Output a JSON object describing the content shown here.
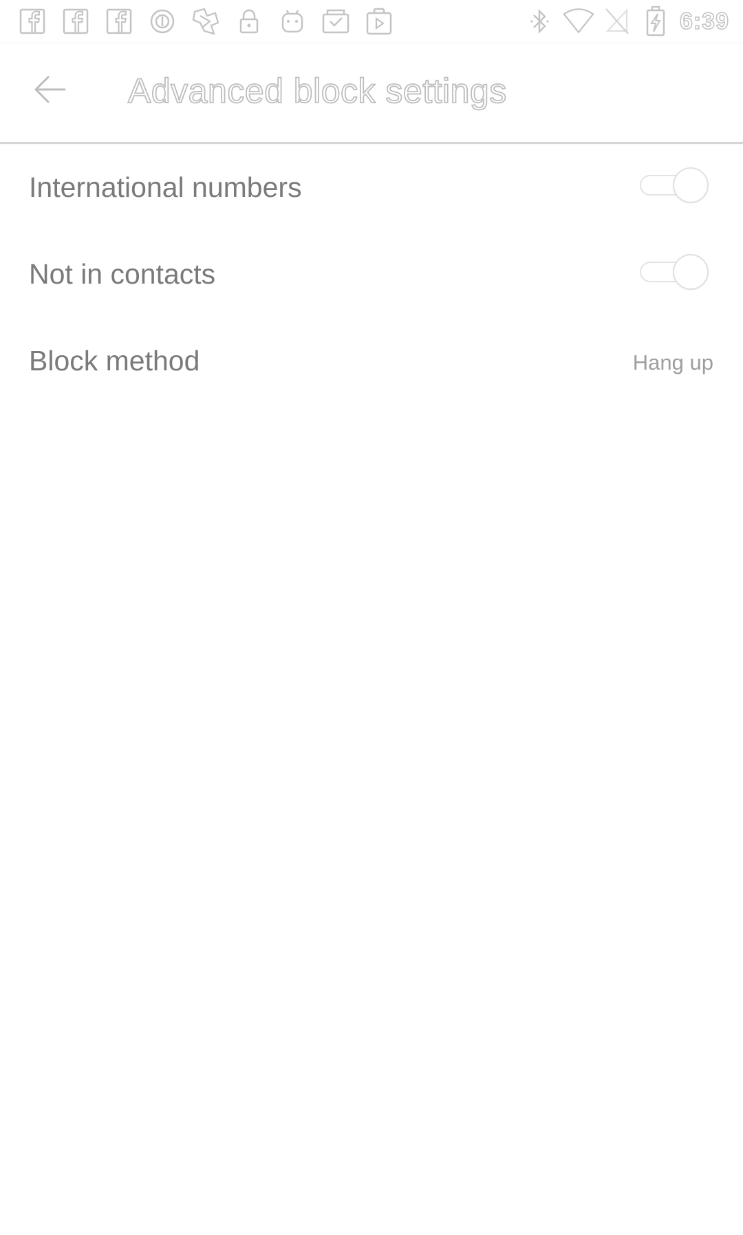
{
  "status_bar": {
    "left_icons": [
      "facebook-icon",
      "facebook-icon",
      "facebook-icon",
      "circle-notification-icon",
      "compass-icon",
      "lock-icon",
      "android-icon",
      "clipboard-check-icon",
      "play-store-icon"
    ],
    "right_icons": [
      "bluetooth-icon",
      "wifi-icon",
      "no-sim-icon",
      "battery-charging-icon"
    ],
    "time": "6:39"
  },
  "toolbar": {
    "title": "Advanced block settings",
    "back_icon": "arrow-left-icon"
  },
  "settings": {
    "items": [
      {
        "label": "International numbers",
        "type": "toggle",
        "enabled": false
      },
      {
        "label": "Not in contacts",
        "type": "toggle",
        "enabled": false
      },
      {
        "label": "Block method",
        "type": "value",
        "value": "Hang up"
      }
    ]
  },
  "colors": {
    "text_primary": "#7a7a7a",
    "text_secondary": "#9e9e9e",
    "icon_outline": "#c4c4c4",
    "background": "#ffffff"
  }
}
